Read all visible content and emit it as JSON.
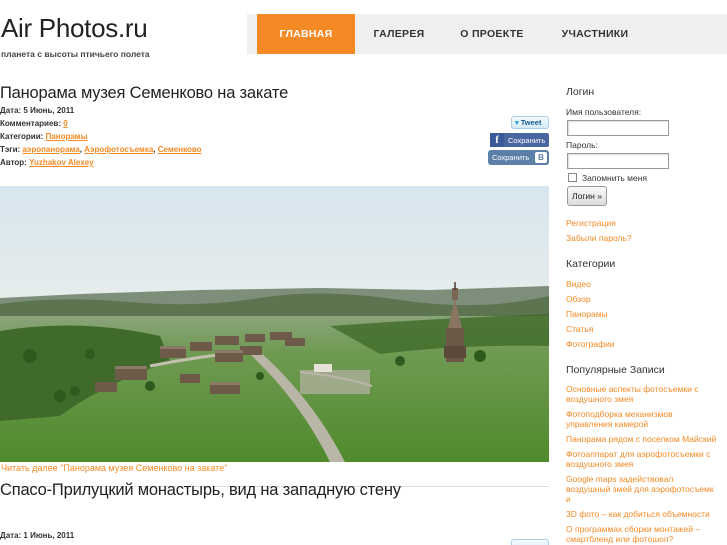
{
  "header": {
    "site_title": "Air Photos.ru",
    "tagline": "планета с высоты птичьего полета"
  },
  "nav": {
    "items": [
      {
        "label": "ГЛАВНАЯ",
        "active": true
      },
      {
        "label": "ГАЛЕРЕЯ",
        "active": false
      },
      {
        "label": "О ПРОЕКТЕ",
        "active": false
      },
      {
        "label": "УЧАСТНИКИ",
        "active": false
      }
    ]
  },
  "post1": {
    "title": "Панорама музея Семенково на закате",
    "date_label": "Дата: 5 Июнь, 2011",
    "comments_prefix": "Комментариев: ",
    "comments_count": "0",
    "categories_prefix": "Категории: ",
    "category": "Панорамы",
    "tags_prefix": "Тэги: ",
    "tags": [
      "аэропанорама",
      "Аэрофотосъемка",
      "Семенково"
    ],
    "tag_sep": ", ",
    "author_prefix": "Автор: ",
    "author": "Yuzhakov Alexey",
    "read_more": "Читать далее \"Панорама музея Семенково на закате\""
  },
  "share": {
    "tweet": "Tweet",
    "fb_icon": "f",
    "fb_label": "Сохранить",
    "vk_label": "Сохранить",
    "vk_icon": "В"
  },
  "post2": {
    "title": "Спасо-Прилуцкий монастырь, вид на западную стену",
    "date_label": "Дата: 1 Июнь, 2011"
  },
  "sidebar": {
    "login_heading": "Логин",
    "username_label": "Имя пользователя:",
    "password_label": "Пароль:",
    "remember_label": "Запомнить меня",
    "login_button": "Логин »",
    "register_link": "Регистрация",
    "forgot_link": "Забыли пароль?",
    "categories_heading": "Категории",
    "categories": [
      "Видео",
      "Обзор",
      "Панорамы",
      "Статья",
      "Фотографии"
    ],
    "popular_heading": "Популярные Записи",
    "popular": [
      [
        "Основные аспекты фотосъемки с",
        "воздушного змея"
      ],
      [
        "Фотоподборка механизмов",
        "управления камерой"
      ],
      [
        "Панорама рядом с поселком Майский"
      ],
      [
        "Фотоаппарат для аэрофотосъемки с",
        "воздушного змея"
      ],
      [
        "Google maps задействовал",
        "воздушный змей для аэрофотосъемк",
        "и"
      ],
      [
        "3D фото – как добиться объемности"
      ],
      [
        "О программах сборки монтажей –",
        "смартбленд или фотошоп?"
      ]
    ]
  }
}
